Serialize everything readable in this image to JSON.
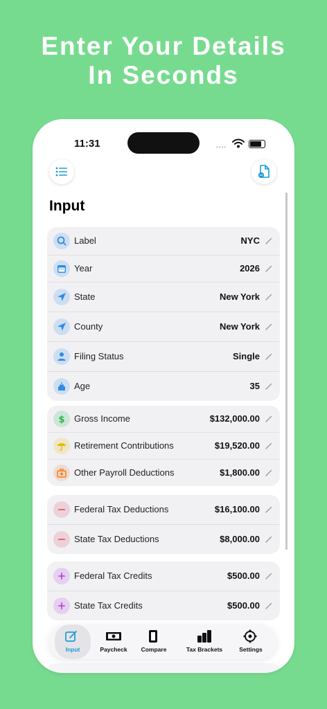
{
  "headline": {
    "line1": "Enter Your Details",
    "line2": "In Seconds"
  },
  "status": {
    "time": "11:31",
    "signal_dots": "••••"
  },
  "header": {
    "menu_icon": "list-icon",
    "doc_icon": "document-icon"
  },
  "page": {
    "title": "Input"
  },
  "sections": [
    {
      "rows": [
        {
          "label": "Label",
          "value": "NYC",
          "icon": "search-icon",
          "color": "#2E8BE6"
        },
        {
          "label": "Year",
          "value": "2026",
          "icon": "calendar-icon",
          "color": "#2E8BE6"
        },
        {
          "label": "State",
          "value": "New York",
          "icon": "location-arrow-icon",
          "color": "#2E8BE6"
        },
        {
          "label": "County",
          "value": "New York",
          "icon": "location-arrow-icon",
          "color": "#2E8BE6"
        },
        {
          "label": "Filing Status",
          "value": "Single",
          "icon": "person-icon",
          "color": "#2E8BE6"
        },
        {
          "label": "Age",
          "value": "35",
          "icon": "cake-icon",
          "color": "#2E8BE6"
        }
      ]
    },
    {
      "rows": [
        {
          "label": "Gross Income",
          "value": "$132,000.00",
          "icon": "dollar-icon",
          "color": "#2FB34F"
        },
        {
          "label": "Retirement Contributions",
          "value": "$19,520.00",
          "icon": "umbrella-icon",
          "color": "#E6B800"
        },
        {
          "label": "Other Payroll Deductions",
          "value": "$1,800.00",
          "icon": "medical-bag-icon",
          "color": "#F07A1A"
        }
      ]
    },
    {
      "rows": [
        {
          "label": "Federal Tax Deductions",
          "value": "$16,100.00",
          "icon": "minus-icon",
          "color": "#E0435A"
        },
        {
          "label": "State Tax Deductions",
          "value": "$8,000.00",
          "icon": "minus-icon",
          "color": "#E0435A"
        }
      ]
    },
    {
      "rows": [
        {
          "label": "Federal Tax Credits",
          "value": "$500.00",
          "icon": "plus-icon",
          "color": "#B23BD6"
        },
        {
          "label": "State Tax Credits",
          "value": "$500.00",
          "icon": "plus-icon",
          "color": "#B23BD6"
        }
      ]
    }
  ],
  "tabs": [
    {
      "label": "Input",
      "icon": "edit-icon",
      "active": true
    },
    {
      "label": "Paycheck",
      "icon": "banknote-icon",
      "active": false
    },
    {
      "label": "Compare",
      "icon": "compare-icon",
      "active": false
    },
    {
      "label": "Tax Brackets",
      "icon": "bar-chart-icon",
      "active": false
    },
    {
      "label": "Settings",
      "icon": "gear-icon",
      "active": false
    }
  ],
  "colors": {
    "background": "#77DB8F",
    "accent": "#1A9BD8",
    "card": "#F1F1F4"
  }
}
